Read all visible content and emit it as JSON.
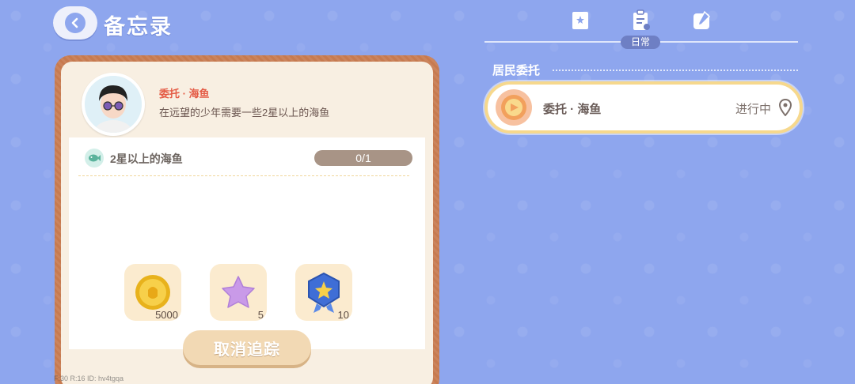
{
  "header": {
    "title": "备忘录"
  },
  "memo": {
    "quest_name": "委托 · 海鱼",
    "quest_desc": "在远望的少年需要一些2星以上的海鱼",
    "task": {
      "label": "2星以上的海鱼",
      "progress": "0/1"
    },
    "rewards": [
      {
        "icon": "gold-coin-icon",
        "qty": "5000"
      },
      {
        "icon": "purple-star-icon",
        "qty": "5"
      },
      {
        "icon": "blue-badge-icon",
        "qty": "10"
      }
    ],
    "untrack_label": "取消追踪"
  },
  "debug": "F:30  R:16  ID: hv4tgqa",
  "tabs": {
    "active_label": "日常"
  },
  "section": {
    "title": "居民委托"
  },
  "commission": {
    "name": "委托 · 海鱼",
    "status": "进行中"
  },
  "colors": {
    "background": "#8ea6ee",
    "card_border": "#c77a4f",
    "quest_title": "#e45a44",
    "highlight_border": "#f6d88d"
  }
}
